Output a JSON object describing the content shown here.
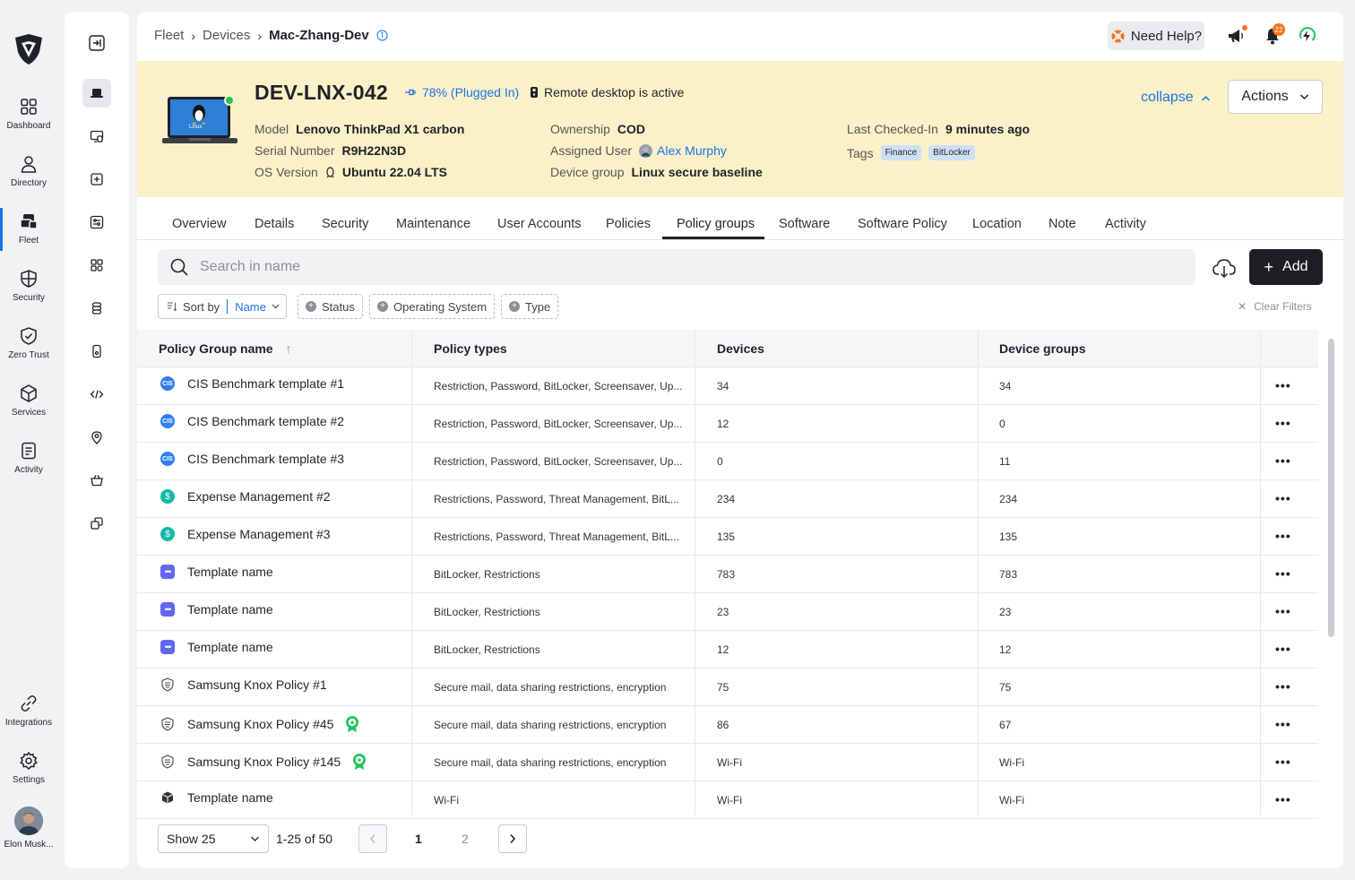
{
  "nav": {
    "items": [
      {
        "label": "Dashboard",
        "icon": "grid-icon"
      },
      {
        "label": "Directory",
        "icon": "user-icon"
      },
      {
        "label": "Fleet",
        "icon": "fleet-icon",
        "active": true
      },
      {
        "label": "Security",
        "icon": "shield-icon"
      },
      {
        "label": "Zero Trust",
        "icon": "shield-check-icon"
      },
      {
        "label": "Services",
        "icon": "box-icon"
      },
      {
        "label": "Activity",
        "icon": "document-icon"
      },
      {
        "label": "Integrations",
        "icon": "link-icon"
      },
      {
        "label": "Settings",
        "icon": "gear-icon"
      }
    ],
    "user_name": "Elon Musk..."
  },
  "breadcrumb": [
    "Fleet",
    "Devices",
    "Mac-Zhang-Dev"
  ],
  "topbar": {
    "help_label": "Need Help?",
    "notification_count": "22"
  },
  "device": {
    "name": "DEV-LNX-042",
    "battery": "78% (Plugged In)",
    "remote_status": "Remote desktop is active",
    "laptop_os_label": "Linux",
    "fields": {
      "model_k": "Model",
      "model_v": "Lenovo ThinkPad X1 carbon",
      "serial_k": "Serial Number",
      "serial_v": "R9H22N3D",
      "os_k": "OS Version",
      "os_v": "Ubuntu 22.04 LTS",
      "ownership_k": "Ownership",
      "ownership_v": "COD",
      "user_k": "Assigned User",
      "user_v": "Alex Murphy",
      "group_k": "Device group",
      "group_v": "Linux secure baseline",
      "checked_k": "Last Checked-In",
      "checked_v": "9 minutes ago",
      "tags_k": "Tags",
      "tag1": "Finance",
      "tag2": "BitLocker"
    },
    "collapse_label": "collapse",
    "actions_label": "Actions"
  },
  "tabs": [
    "Overview",
    "Details",
    "Security",
    "Maintenance",
    "User Accounts",
    "Policies",
    "Policy groups",
    "Software",
    "Software Policy",
    "Location",
    "Note",
    "Activity"
  ],
  "active_tab": "Policy groups",
  "search": {
    "placeholder": "Search in name"
  },
  "add_label": "Add",
  "filters": {
    "sort_label": "Sort by",
    "sort_value": "Name",
    "chips": [
      "Status",
      "Operating System",
      "Type"
    ],
    "clear_label": "Clear Filters"
  },
  "table": {
    "headers": [
      "Policy Group name",
      "Policy types",
      "Devices",
      "Device groups"
    ],
    "rows": [
      {
        "name": "CIS Benchmark template #1",
        "types": "Restriction, Password, BitLocker, Screensaver, Up...",
        "devices": "34",
        "groups": "34",
        "icon": "cis-icon"
      },
      {
        "name": "CIS Benchmark template #2",
        "types": "Restriction, Password, BitLocker, Screensaver, Up...",
        "devices": "12",
        "groups": "0",
        "icon": "cis-icon"
      },
      {
        "name": "CIS Benchmark template #3",
        "types": "Restriction, Password, BitLocker, Screensaver, Up...",
        "devices": "0",
        "groups": "11",
        "icon": "cis-icon"
      },
      {
        "name": "Expense Management #2",
        "types": "Restrictions, Password, Threat Management, BitL...",
        "devices": "234",
        "groups": "234",
        "icon": "dollar-icon"
      },
      {
        "name": "Expense Management #3",
        "types": "Restrictions, Password, Threat Management, BitL...",
        "devices": "135",
        "groups": "135",
        "icon": "dollar-icon"
      },
      {
        "name": "Template name",
        "types": "BitLocker, Restrictions",
        "devices": "783",
        "groups": "783",
        "icon": "dots-icon"
      },
      {
        "name": "Template name",
        "types": "BitLocker, Restrictions",
        "devices": "23",
        "groups": "23",
        "icon": "dots-icon"
      },
      {
        "name": "Template name",
        "types": "BitLocker, Restrictions",
        "devices": "12",
        "groups": "12",
        "icon": "dots-icon"
      },
      {
        "name": "Samsung Knox Policy #1",
        "types": "Secure mail, data sharing restrictions, encryption",
        "devices": "75",
        "groups": "75",
        "icon": "knox-icon"
      },
      {
        "name": "Samsung Knox Policy #45",
        "types": "Secure mail, data sharing restrictions, encryption",
        "devices": "86",
        "groups": "67",
        "icon": "knox-icon",
        "award": true
      },
      {
        "name": "Samsung Knox Policy #145",
        "types": "Secure mail, data sharing restrictions, encryption",
        "devices": "Wi-Fi",
        "groups": "Wi-Fi",
        "icon": "knox-icon",
        "award": true
      },
      {
        "name": "Template name",
        "types": "Wi-Fi",
        "devices": "Wi-Fi",
        "groups": "Wi-Fi",
        "icon": "package-icon"
      }
    ]
  },
  "pagination": {
    "show": "Show 25",
    "range": "1-25 of 50",
    "pages": [
      "1",
      "2"
    ]
  },
  "colors": {
    "accent": "#1a73e8",
    "banner": "#fbf1c9",
    "primary_button": "#1c1e22",
    "online": "#22c55e"
  }
}
